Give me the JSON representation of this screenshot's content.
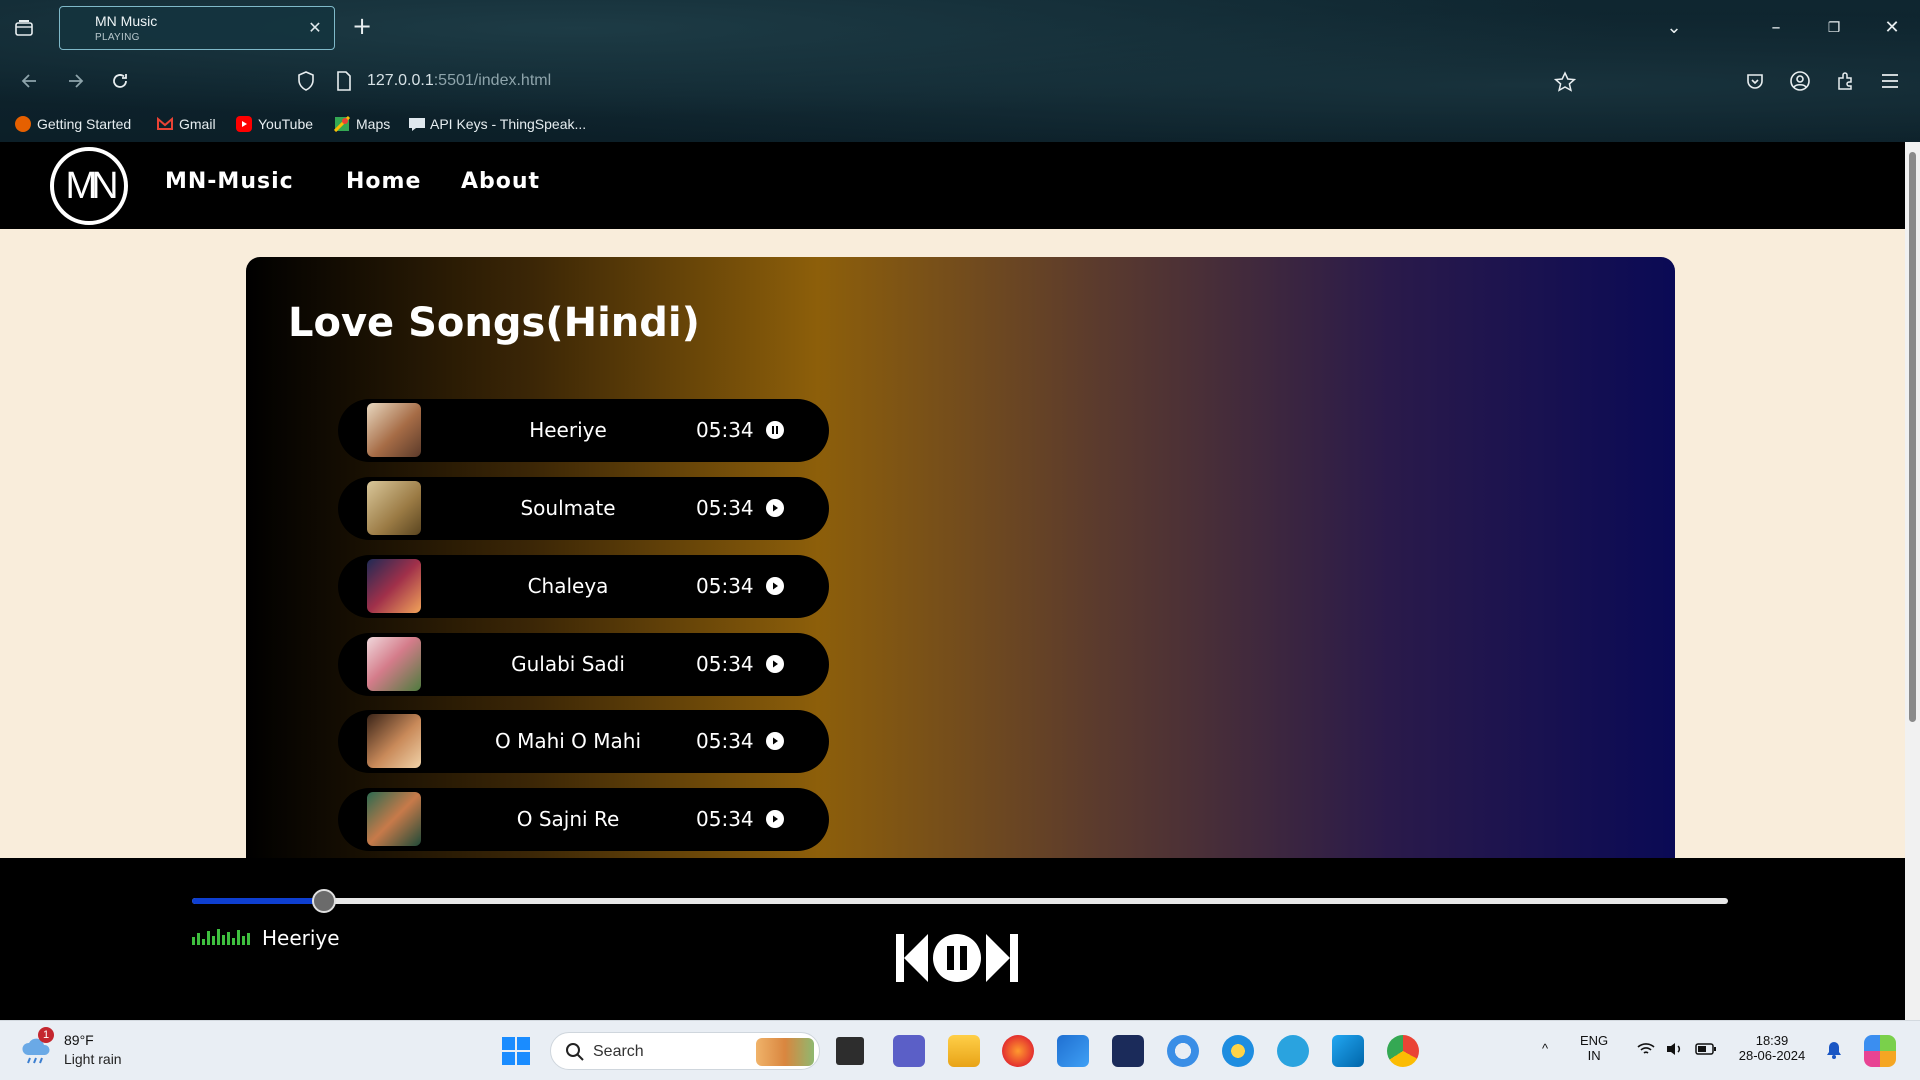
{
  "browser": {
    "tab": {
      "title": "MN Music",
      "status": "PLAYING"
    },
    "url": {
      "host": "127.0.0.1",
      "rest": ":5501/index.html"
    },
    "bookmarks": [
      {
        "label": "Getting Started",
        "icon": "firefox-icon",
        "color": "#e66000"
      },
      {
        "label": "Gmail",
        "icon": "gmail-icon",
        "color": "#ea4335"
      },
      {
        "label": "YouTube",
        "icon": "youtube-icon",
        "color": "#ff0000"
      },
      {
        "label": "Maps",
        "icon": "maps-icon",
        "color": "#34a853"
      },
      {
        "label": "API Keys - ThingSpeak...",
        "icon": "thingspeak-icon",
        "color": "#dfe8ee"
      }
    ]
  },
  "site": {
    "logo_text": "MN",
    "nav": {
      "brand": "MN-Music",
      "home": "Home",
      "about": "About"
    }
  },
  "playlist": {
    "title": "Love Songs(Hindi)",
    "songs": [
      {
        "name": "Heeriye",
        "duration": "05:34",
        "state": "pause",
        "art": "#b48a62"
      },
      {
        "name": "Soulmate",
        "duration": "05:34",
        "state": "play",
        "art": "#b49258"
      },
      {
        "name": "Chaleya",
        "duration": "05:34",
        "state": "play",
        "art": "#6a2d3c"
      },
      {
        "name": "Gulabi Sadi",
        "duration": "05:34",
        "state": "play",
        "art": "#c97d85"
      },
      {
        "name": "O Mahi O Mahi",
        "duration": "05:34",
        "state": "play",
        "art": "#8a6040"
      },
      {
        "name": "O Sajni Re",
        "duration": "05:34",
        "state": "play",
        "art": "#2f6a4f"
      }
    ]
  },
  "player": {
    "progress_fraction": 0.086,
    "now_playing": "Heeriye",
    "accent": "#0e3fd1"
  },
  "taskbar": {
    "weather": {
      "temp": "89°F",
      "desc": "Light rain",
      "badge": "1"
    },
    "search_placeholder": "Search",
    "lang": {
      "line1": "ENG",
      "line2": "IN"
    },
    "clock": {
      "time": "18:39",
      "date": "28-06-2024"
    }
  }
}
